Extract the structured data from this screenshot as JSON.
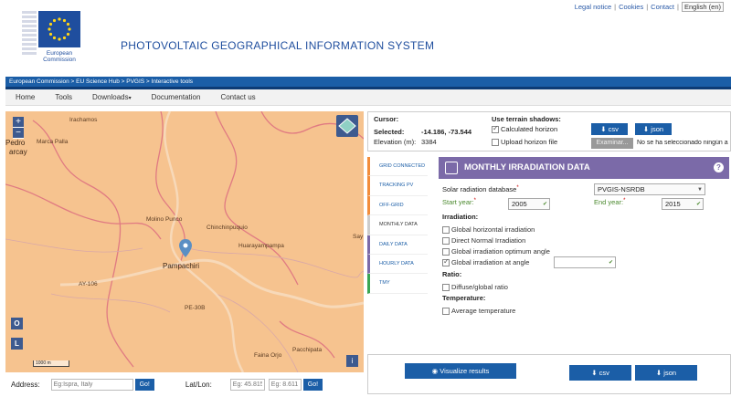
{
  "top_links": {
    "legal": "Legal notice",
    "cookies": "Cookies",
    "contact": "Contact",
    "lang": "English (en)"
  },
  "header": {
    "title": "PHOTOVOLTAIC GEOGRAPHICAL INFORMATION SYSTEM",
    "logo_line1": "European",
    "logo_line2": "Commission"
  },
  "breadcrumb": "European Commission > EU Science Hub > PVGIS > Interactive tools",
  "nav": [
    "Home",
    "Tools",
    "Downloads",
    "Documentation",
    "Contact us"
  ],
  "map": {
    "places": [
      "Irachamos",
      "Pedro",
      "arcay",
      "Marca Palla",
      "Molino Punco",
      "Chinchinpuquio",
      "Huarayampampa",
      "Pampachiri",
      "AY-106",
      "PE-30B",
      "Pacchipata",
      "Faina Orjo",
      "Say"
    ],
    "zoom_in": "+",
    "zoom_out": "−",
    "btn_o": "O",
    "btn_l": "L",
    "scale": "1000 m",
    "info": "i"
  },
  "address": {
    "label": "Address:",
    "placeholder": "Eg:Ispra, Italy",
    "go": "Go!",
    "latlon_label": "Lat/Lon:",
    "lat_ph": "Eg: 45.815",
    "lon_ph": "Eg: 8.611",
    "go2": "Go!"
  },
  "cursor": {
    "title": "Cursor:",
    "selected_label": "Selected:",
    "selected_value": "-14.186, -73.544",
    "elev_label": "Elevation (m):",
    "elev_value": "3384",
    "terrain_title": "Use terrain shadows:",
    "calc_horizon": "Calculated horizon",
    "upload_horizon": "Upload horizon file",
    "csv": "csv",
    "json": "json",
    "browse": "Examinar...",
    "no_file": "No se ha seleccionado ningún a"
  },
  "tabs": [
    "GRID CONNECTED",
    "TRACKING PV",
    "OFF-GRID",
    "MONTHLY DATA",
    "DAILY DATA",
    "HOURLY DATA",
    "TMY"
  ],
  "monthly": {
    "title": "MONTHLY IRRADIATION DATA",
    "help": "?",
    "db_label": "Solar radiation database",
    "db_value": "PVGIS-NSRDB",
    "start_label": "Start year:",
    "start_value": "2005",
    "end_label": "End year:",
    "end_value": "2015",
    "irr_title": "Irradiation:",
    "opt1": "Global horizontal irradiation",
    "opt2": "Direct Normal Irradiation",
    "opt3": "Global irradiation optimum angle",
    "opt4": "Global irradiation at angle",
    "ratio_title": "Ratio:",
    "opt5": "Diffuse/global ratio",
    "temp_title": "Temperature:",
    "opt6": "Average temperature"
  },
  "bottom": {
    "visualize": "Visualize results",
    "csv": "csv",
    "json": "json"
  },
  "colors": {
    "primary": "#1b5ea7",
    "purple": "#7b6aa8",
    "map": "#f6c38f"
  }
}
